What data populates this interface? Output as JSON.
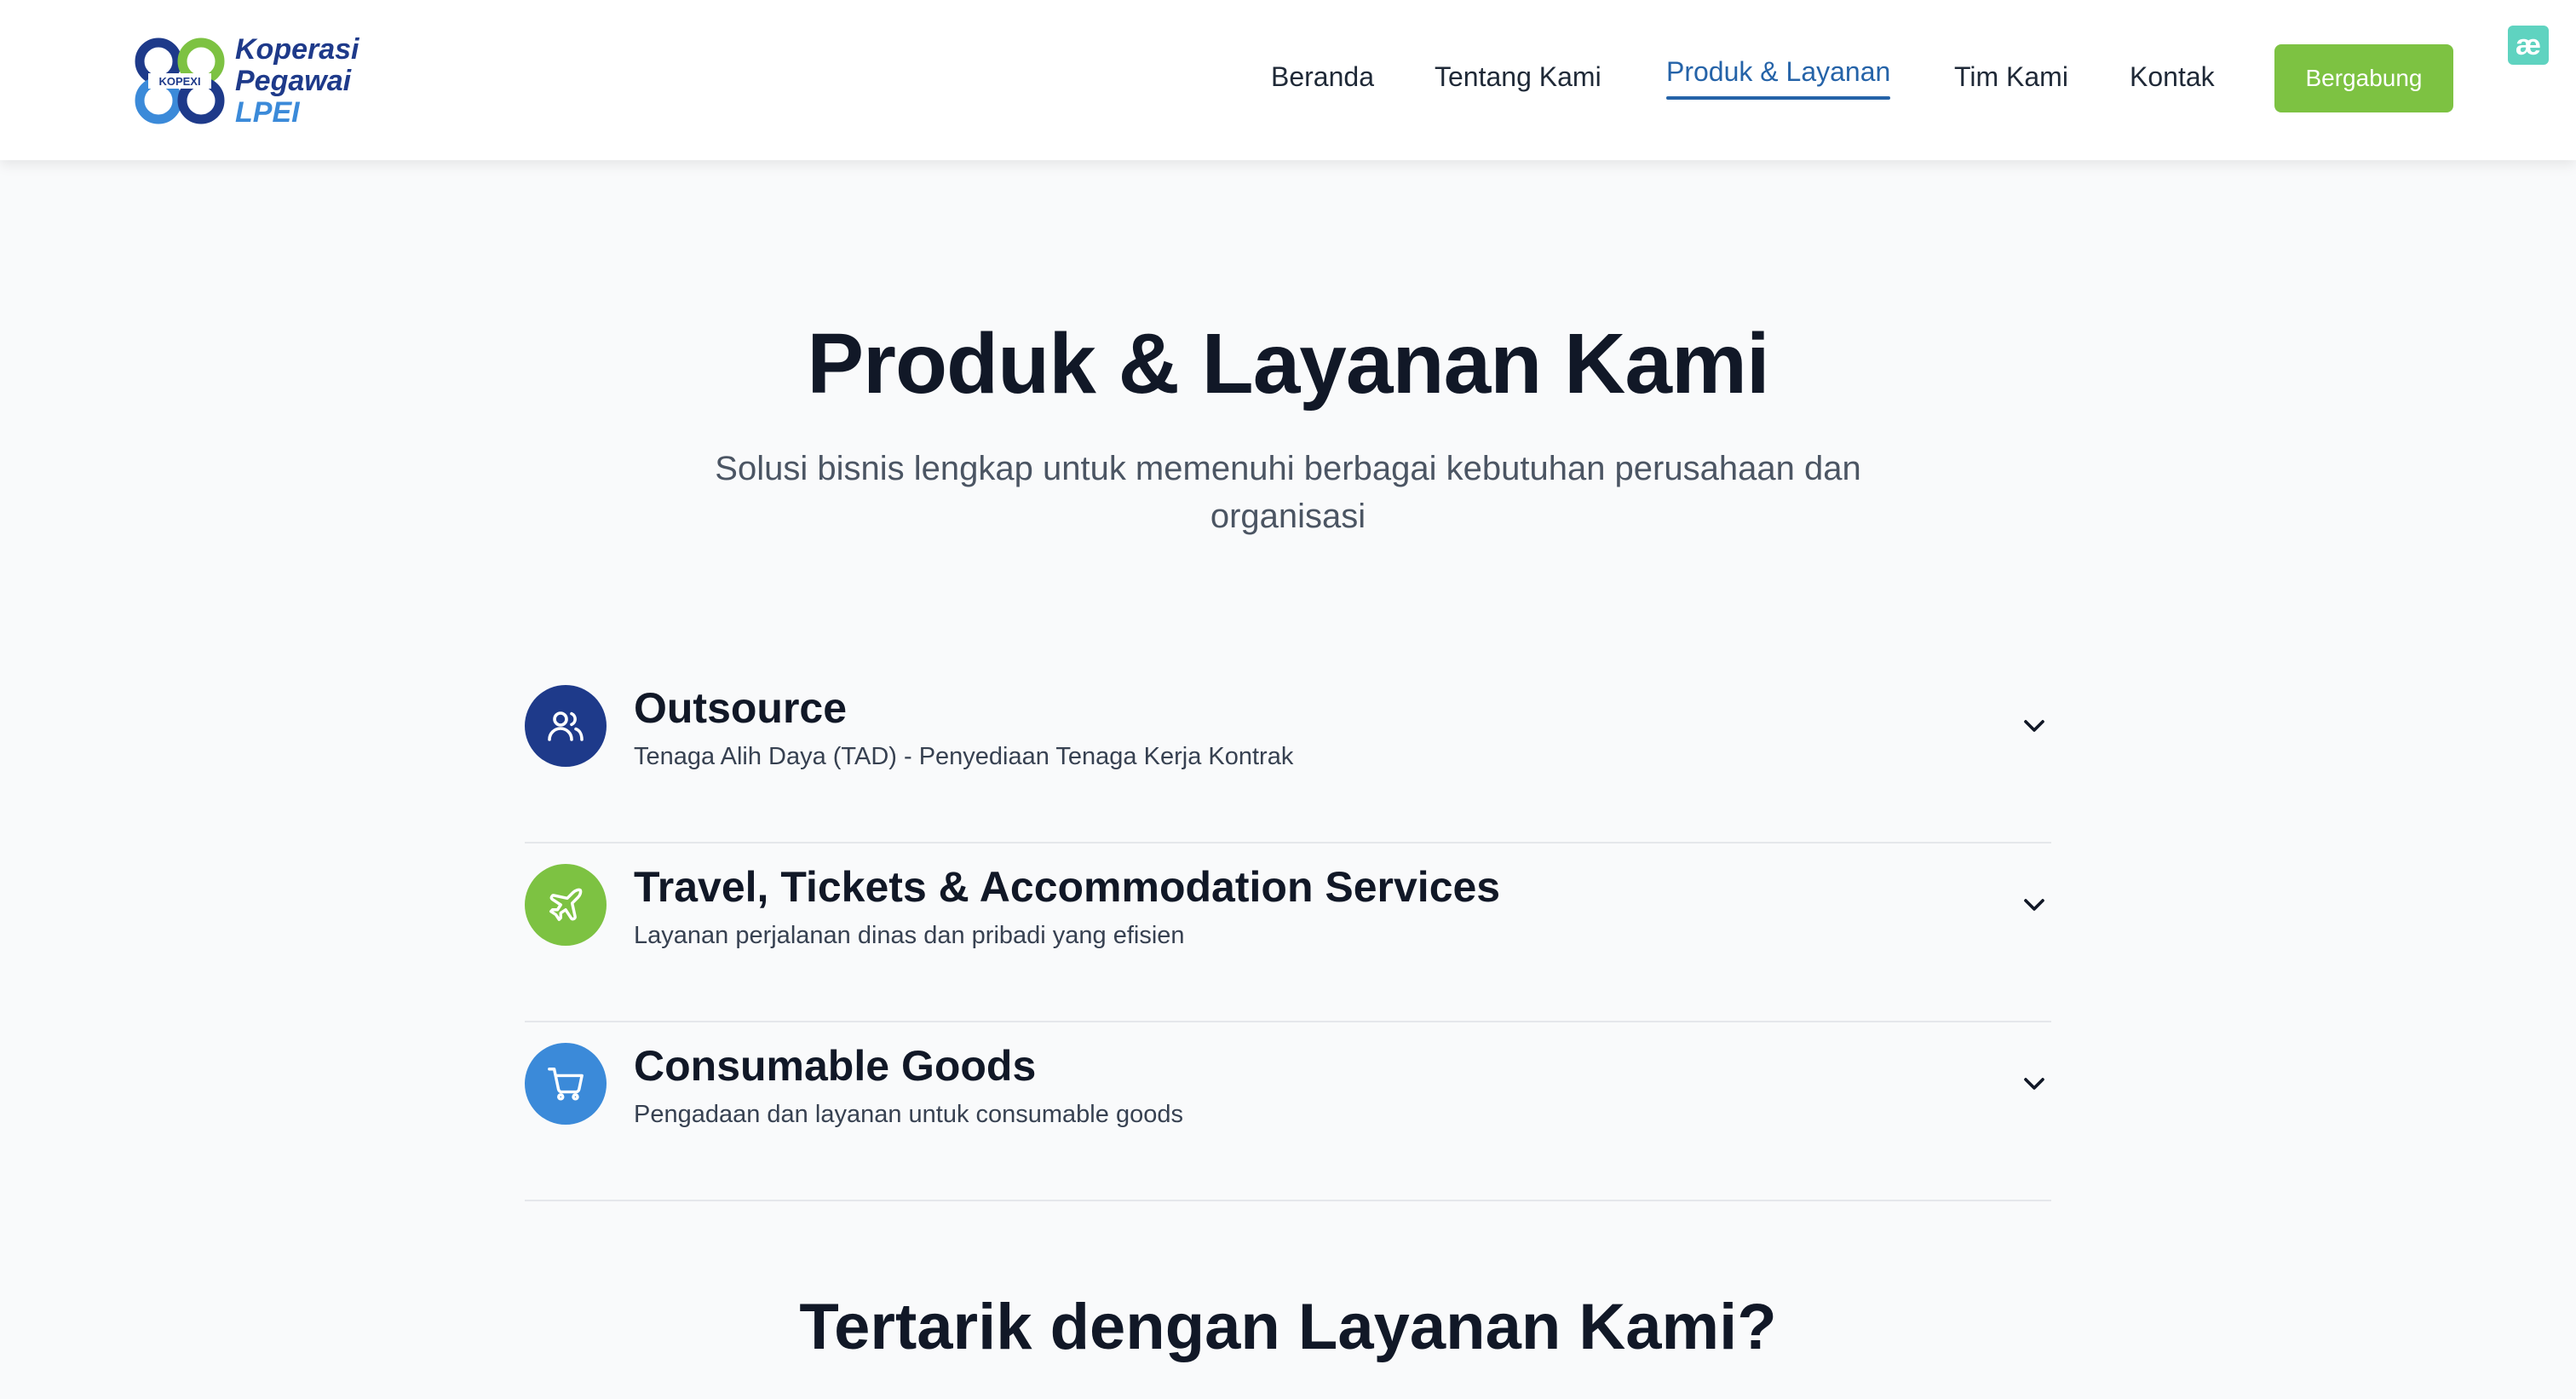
{
  "brand": {
    "logo_mark_text": "KOPEXI",
    "line1": "Koperasi",
    "line2": "Pegawai",
    "line3": "LPEI",
    "colors": {
      "navy": "#1e3a8a",
      "blue": "#3b8ad9",
      "green": "#7dc242"
    }
  },
  "nav": {
    "items": [
      {
        "label": "Beranda"
      },
      {
        "label": "Tentang Kami"
      },
      {
        "label": "Produk & Layanan",
        "active": true
      },
      {
        "label": "Tim Kami"
      },
      {
        "label": "Kontak"
      }
    ],
    "cta_label": "Bergabung"
  },
  "extension_badge": {
    "text": "æ",
    "icon": "extension-icon"
  },
  "hero": {
    "title": "Produk & Layanan Kami",
    "subtitle": "Solusi bisnis lengkap untuk memenuhi berbagai kebutuhan perusahaan dan organisasi"
  },
  "services": [
    {
      "title": "Outsource",
      "description": "Tenaga Alih Daya (TAD) - Penyediaan Tenaga Kerja Kontrak",
      "icon": "users-icon",
      "color": "#1e3a8a"
    },
    {
      "title": "Travel, Tickets & Accommodation Services",
      "description": "Layanan perjalanan dinas dan pribadi yang efisien",
      "icon": "plane-icon",
      "color": "#7dc242"
    },
    {
      "title": "Consumable Goods",
      "description": "Pengadaan dan layanan untuk consumable goods",
      "icon": "cart-icon",
      "color": "#3b8ad9"
    }
  ],
  "cta": {
    "title": "Tertarik dengan Layanan Kami?"
  }
}
